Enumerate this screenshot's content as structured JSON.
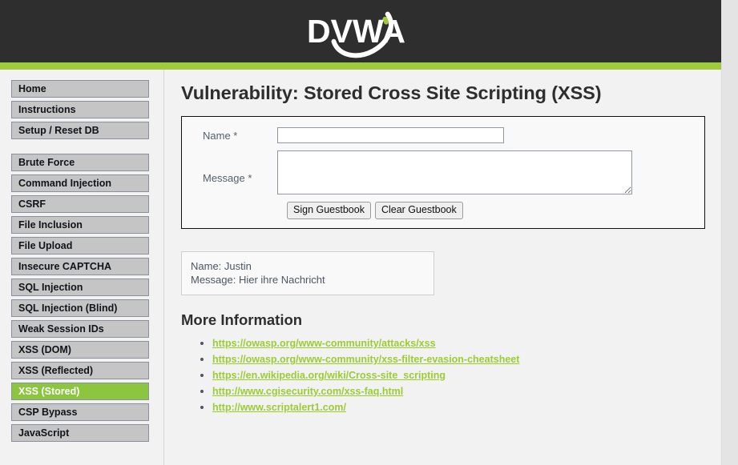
{
  "header": {
    "logo_text": "DVWA",
    "logo_alt": "dvwa-logo",
    "bg_color": "#2e2e2e",
    "accent_color": "#9fcb3b"
  },
  "sidebar": {
    "groups": [
      {
        "items": [
          {
            "label": "Home",
            "active": false
          },
          {
            "label": "Instructions",
            "active": false
          },
          {
            "label": "Setup / Reset DB",
            "active": false
          }
        ]
      },
      {
        "items": [
          {
            "label": "Brute Force",
            "active": false
          },
          {
            "label": "Command Injection",
            "active": false
          },
          {
            "label": "CSRF",
            "active": false
          },
          {
            "label": "File Inclusion",
            "active": false
          },
          {
            "label": "File Upload",
            "active": false
          },
          {
            "label": "Insecure CAPTCHA",
            "active": false
          },
          {
            "label": "SQL Injection",
            "active": false
          },
          {
            "label": "SQL Injection (Blind)",
            "active": false
          },
          {
            "label": "Weak Session IDs",
            "active": false
          },
          {
            "label": "XSS (DOM)",
            "active": false
          },
          {
            "label": "XSS (Reflected)",
            "active": false
          },
          {
            "label": "XSS (Stored)",
            "active": true
          },
          {
            "label": "CSP Bypass",
            "active": false
          },
          {
            "label": "JavaScript",
            "active": false
          }
        ]
      }
    ],
    "active_color": "#8cc63e",
    "item_bg": "#c5c5c5"
  },
  "main": {
    "page_title": "Vulnerability: Stored Cross Site Scripting (XSS)",
    "form": {
      "name_label": "Name *",
      "name_value": "",
      "name_placeholder": "",
      "message_label": "Message *",
      "message_value": "",
      "message_placeholder": "",
      "sign_button": "Sign Guestbook",
      "clear_button": "Clear Guestbook"
    },
    "guestbook": {
      "entries": [
        {
          "name_line": "Name: Justin",
          "message_line": "Message: Hier ihre Nachricht"
        }
      ]
    },
    "more_information": {
      "title": "More Information",
      "links": [
        "https://owasp.org/www-community/attacks/xss",
        "https://owasp.org/www-community/xss-filter-evasion-cheatsheet",
        "https://en.wikipedia.org/wiki/Cross-site_scripting",
        "http://www.cgisecurity.com/xss-faq.html",
        "http://www.scriptalert1.com/"
      ],
      "link_color": "#9acd32"
    }
  }
}
